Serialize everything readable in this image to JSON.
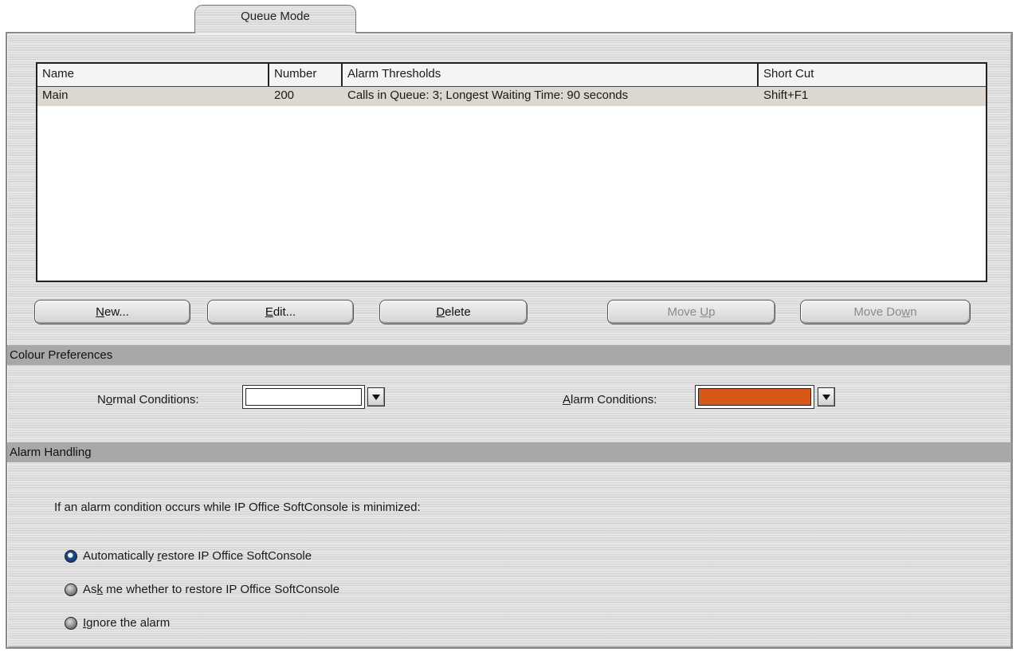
{
  "tab": {
    "label": "Queue Mode"
  },
  "table": {
    "columns": [
      "Name",
      "Number",
      "Alarm Thresholds",
      "Short Cut"
    ],
    "rows": [
      {
        "name": "Main",
        "number": "200",
        "alarm_thresholds": "Calls in Queue: 3; Longest Waiting Time: 90 seconds",
        "short_cut": "Shift+F1"
      }
    ]
  },
  "buttons": {
    "new": {
      "pre": "",
      "key": "N",
      "post": "ew...",
      "enabled": true
    },
    "edit": {
      "pre": "",
      "key": "E",
      "post": "dit...",
      "enabled": true
    },
    "delete": {
      "pre": "",
      "key": "D",
      "post": "elete",
      "enabled": true
    },
    "move_up": {
      "pre": "Move ",
      "key": "U",
      "post": "p",
      "enabled": false
    },
    "move_down": {
      "pre": "Move Do",
      "key": "w",
      "post": "n",
      "enabled": false
    }
  },
  "colour_preferences": {
    "header": "Colour Preferences",
    "normal": {
      "pre": "N",
      "key": "o",
      "post": "rmal Conditions:",
      "color": "#ffffff"
    },
    "alarm": {
      "pre": "",
      "key": "A",
      "post": "larm Conditions:",
      "color": "#d8581a"
    }
  },
  "alarm_handling": {
    "header": "Alarm Handling",
    "prompt": "If an alarm condition occurs while IP Office SoftConsole is minimized:",
    "options": [
      {
        "pre": "Automatically ",
        "key": "r",
        "post": "estore IP Office SoftConsole",
        "checked": true
      },
      {
        "pre": "As",
        "key": "k",
        "post": " me whether to restore IP Office SoftConsole",
        "checked": false
      },
      {
        "pre": "",
        "key": "I",
        "post": "gnore the alarm",
        "checked": false
      }
    ]
  }
}
